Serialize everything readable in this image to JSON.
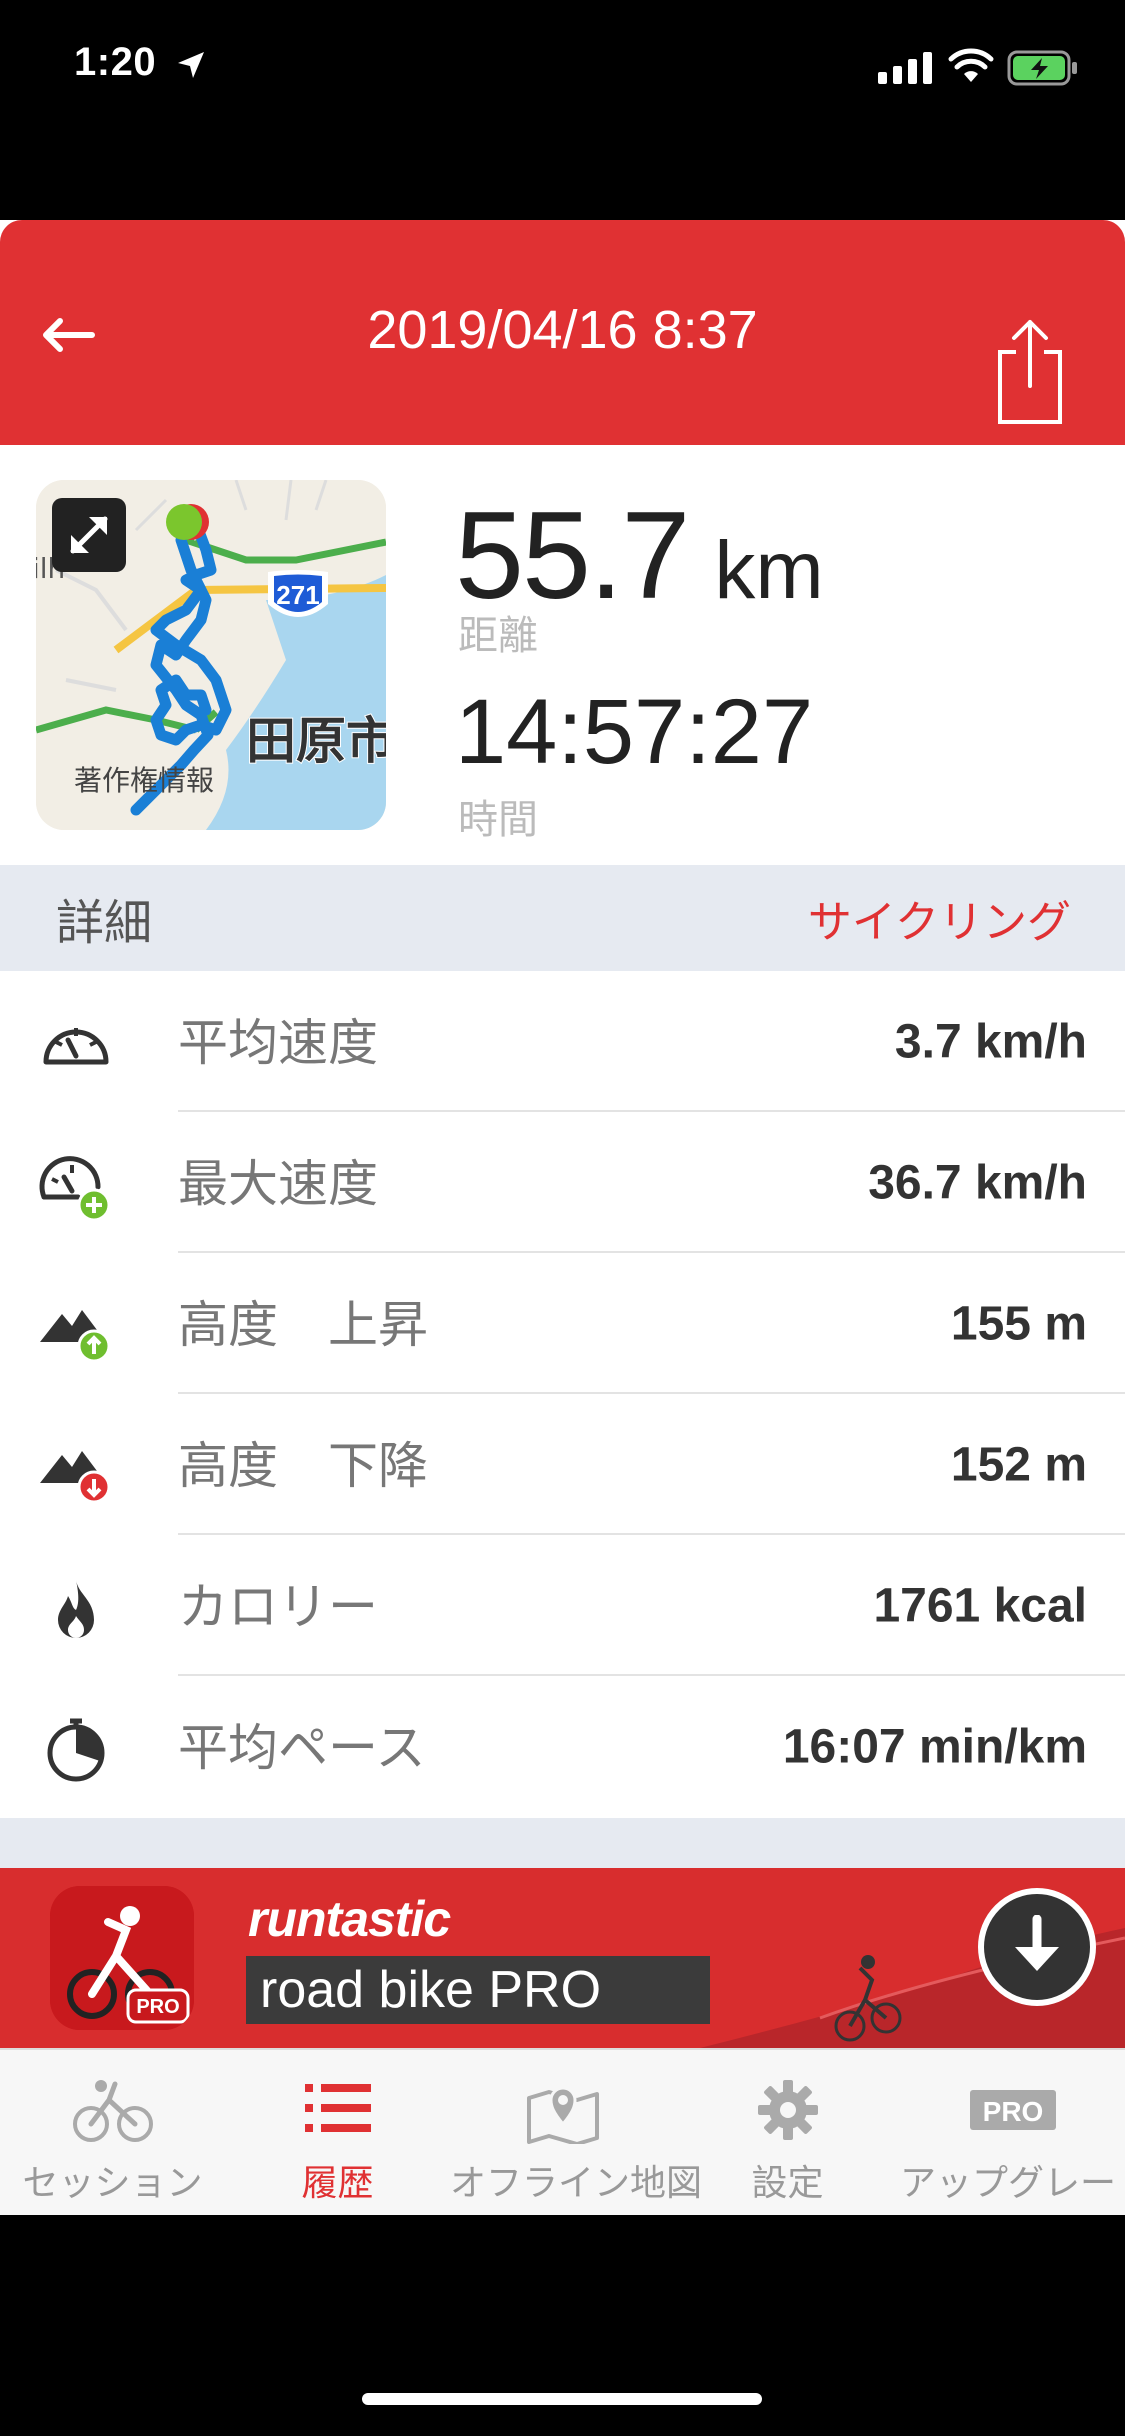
{
  "status_bar": {
    "time": "1:20"
  },
  "header": {
    "title": "2019/04/16 8:37"
  },
  "summary": {
    "distance_value": "55.7",
    "distance_unit": "km",
    "distance_label": "距離",
    "duration_value": "14:57:27",
    "duration_label": "時間",
    "map": {
      "route_badge": "271",
      "city_label": "田原市",
      "copyright_label": "著作権情報",
      "edge_text": "ilh"
    }
  },
  "details": {
    "title": "詳細",
    "activity_type": "サイクリング",
    "rows": [
      {
        "icon": "speedometer-icon",
        "label": "平均速度",
        "value": "3.7 km/h"
      },
      {
        "icon": "speedometer-plus-icon",
        "label": "最大速度",
        "value": "36.7 km/h"
      },
      {
        "icon": "mountain-up-icon",
        "label": "高度　上昇",
        "value": "155 m"
      },
      {
        "icon": "mountain-down-icon",
        "label": "高度　下降",
        "value": "152 m"
      },
      {
        "icon": "flame-icon",
        "label": "カロリー",
        "value": "1761 kcal"
      },
      {
        "icon": "stopwatch-icon",
        "label": "平均ペース",
        "value": "16:07 min/km"
      }
    ]
  },
  "promo": {
    "brand": "runtastic",
    "product": "road bike PRO",
    "badge": "PRO"
  },
  "tabbar": {
    "tabs": [
      {
        "label": "セッション",
        "icon": "cyclist-icon",
        "active": false
      },
      {
        "label": "履歴",
        "icon": "list-icon",
        "active": true
      },
      {
        "label": "オフライン地図",
        "icon": "map-pin-icon",
        "active": false
      },
      {
        "label": "設定",
        "icon": "gear-icon",
        "active": false
      },
      {
        "label": "アップグレード",
        "icon": "pro-badge-icon",
        "active": false,
        "badge": "PRO"
      }
    ]
  },
  "colors": {
    "accent": "#e03133",
    "route": "#1a7fd6",
    "start_marker": "#7bc62d"
  }
}
